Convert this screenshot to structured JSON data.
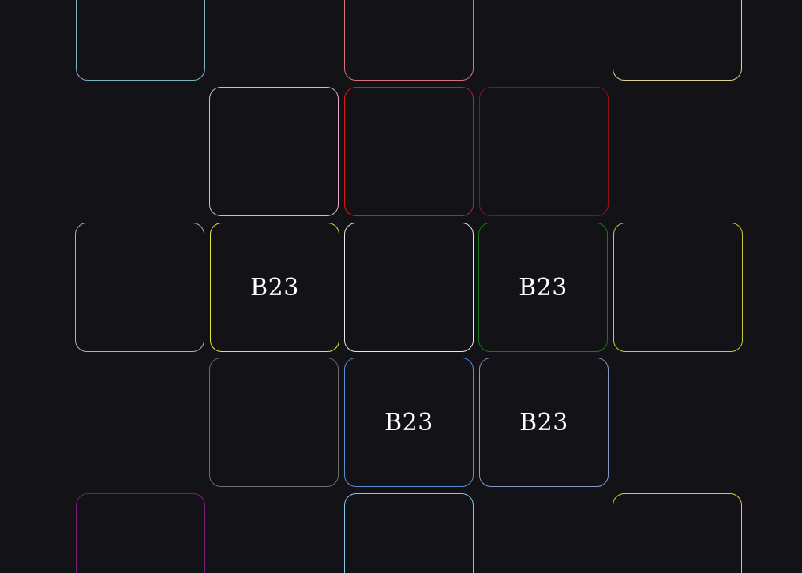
{
  "board": {
    "background": "#131317",
    "tiles": [
      {
        "id": "r0c0",
        "color": "#7fb3c3",
        "label": ""
      },
      {
        "id": "r0c2",
        "color": "#d9707c",
        "label": ""
      },
      {
        "id": "r0c4",
        "color": "#d8d28a",
        "label": ""
      },
      {
        "id": "r1c1",
        "color": "#e3b2c8",
        "label": ""
      },
      {
        "id": "r1c2",
        "color": "#d4181c",
        "label": ""
      },
      {
        "id": "r1c3",
        "color": "#8e1216",
        "label": ""
      },
      {
        "id": "r2c0",
        "color": "#b0b0b0",
        "label": ""
      },
      {
        "id": "r2c1",
        "color": "#e6e640",
        "label": "B23"
      },
      {
        "id": "r2c2",
        "color": "#e8e8e8",
        "label": ""
      },
      {
        "id": "r2c3",
        "color": "#177a17",
        "label": "B23"
      },
      {
        "id": "r2c4",
        "color": "#c9c93a",
        "label": ""
      },
      {
        "id": "r3c1",
        "color": "#6e6e6e",
        "label": ""
      },
      {
        "id": "r3c2",
        "color": "#5b8fd6",
        "label": "B23"
      },
      {
        "id": "r3c3",
        "color": "#8a98c9",
        "label": "B23"
      },
      {
        "id": "r4c0",
        "color": "#7d1a7d",
        "label": ""
      },
      {
        "id": "r4c2",
        "color": "#86c6ea",
        "label": ""
      },
      {
        "id": "r4c4",
        "color": "#e6c441",
        "label": ""
      }
    ]
  }
}
